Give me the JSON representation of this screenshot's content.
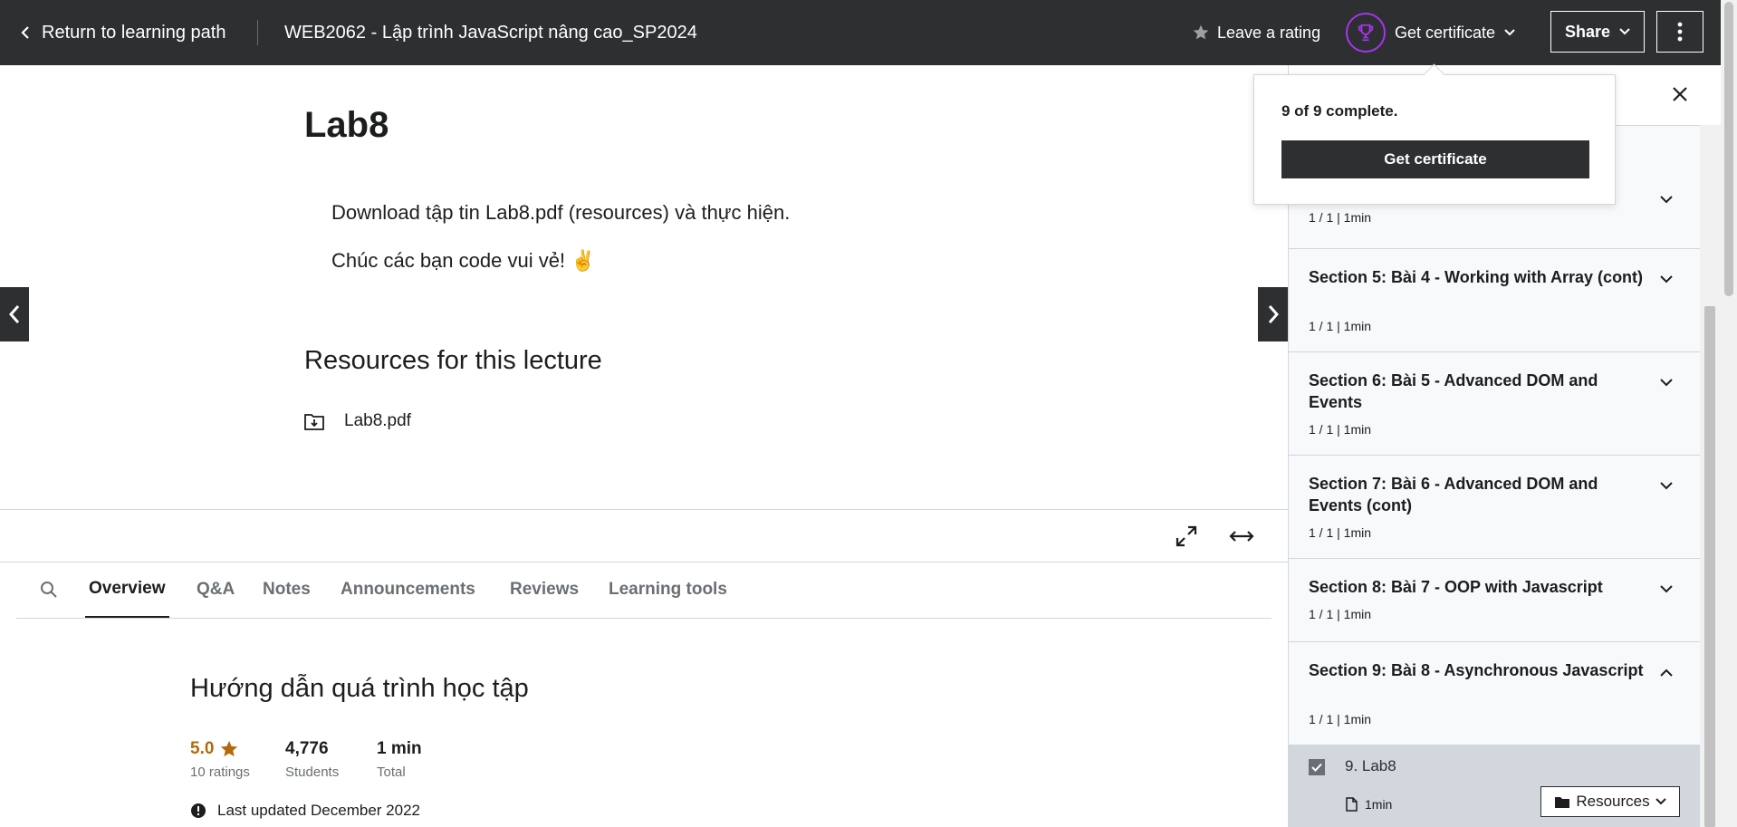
{
  "header": {
    "back_label": "Return to learning path",
    "course_title": "WEB2062 - Lập trình JavaScript nâng cao_SP2024",
    "rating_label": "Leave a rating",
    "certificate_label": "Get certificate",
    "share_label": "Share"
  },
  "lecture": {
    "title": "Lab8",
    "paragraphs": [
      "Download tập tin Lab8.pdf (resources) và thực hiện.",
      "Chúc các bạn code vui vẻ! ✌️"
    ],
    "resources_title": "Resources for this lecture",
    "resource_file": "Lab8.pdf"
  },
  "tabs": [
    "Overview",
    "Q&A",
    "Notes",
    "Announcements",
    "Reviews",
    "Learning tools"
  ],
  "overview": {
    "title": "Hướng dẫn quá trình học tập",
    "rating_value": "5.0",
    "rating_count": "10 ratings",
    "students_value": "4,776",
    "students_label": "Students",
    "total_value": "1 min",
    "total_label": "Total",
    "last_updated": "Last updated December 2022"
  },
  "popover": {
    "progress_text": "9 of 9 complete.",
    "button_label": "Get certificate"
  },
  "sidebar": {
    "partial_section_meta": "1 / 1 | 1min",
    "sections": [
      {
        "title": "Section 5: Bài 4 - Working with Array (cont)",
        "meta": "1 / 1 | 1min"
      },
      {
        "title": "Section 6: Bài 5 - Advanced DOM and Events",
        "meta": "1 / 1 | 1min"
      },
      {
        "title": "Section 7: Bài 6 - Advanced DOM and Events (cont)",
        "meta": "1 / 1 | 1min"
      },
      {
        "title": "Section 8: Bài 7 - OOP with Javascript",
        "meta": "1 / 1 | 1min"
      },
      {
        "title": "Section 9: Bài 8 - Asynchronous Javascript",
        "meta": "1 / 1 | 1min"
      }
    ],
    "item": {
      "title": "9. Lab8",
      "duration": "1min",
      "resources_label": "Resources",
      "completed": true
    }
  },
  "colors": {
    "header_bg": "#2d2f31",
    "accent": "#a435f0",
    "rating_star": "#b4690e"
  }
}
